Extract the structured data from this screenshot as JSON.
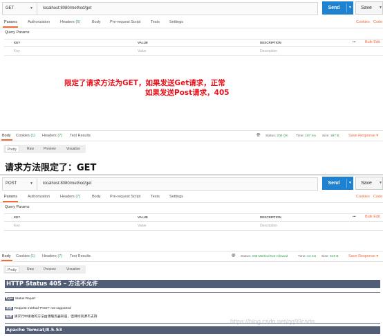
{
  "panel1": {
    "method": "GET",
    "url": "localhost:8080/method/get",
    "send": "Send",
    "save": "Save",
    "tabs": [
      "Params",
      "Authorization",
      "Headers",
      "Body",
      "Pre-request Script",
      "Tests",
      "Settings"
    ],
    "headers_count": "(6)",
    "cookies": "Cookies",
    "code": "Code",
    "query_params": "Query Params",
    "columns": [
      "KEY",
      "VALUE",
      "DESCRIPTION"
    ],
    "dots": "•••",
    "bulk_edit": "Bulk Edit",
    "placeholders": [
      "Key",
      "Value",
      "Description"
    ]
  },
  "annotation": {
    "line1": "限定了请求方法为GET，如果发送Get请求，正常",
    "line2": "如果发送Post请求，405",
    "color": "#e8101b"
  },
  "response1": {
    "tabs": [
      "Body",
      "Cookies",
      "(1)",
      "Headers",
      "(7)",
      "Test Results"
    ],
    "status_label": "Status:",
    "status_value": "200 OK",
    "time_label": "Time:",
    "time_value": "197 ms",
    "size_label": "Size:",
    "size_value": "387 B",
    "save_response": "Save Response",
    "view_tabs": [
      "Pretty",
      "Raw",
      "Preview",
      "Visualize"
    ]
  },
  "heading": "请求方法限定了：GET",
  "panel2": {
    "method": "POST",
    "url": "localhost:8080/method/get",
    "send": "Send",
    "save": "Save",
    "tabs": [
      "Params",
      "Authorization",
      "Headers",
      "Body",
      "Pre-request Script",
      "Tests",
      "Settings"
    ],
    "headers_count": "(7)",
    "cookies": "Cookies",
    "code": "Code",
    "query_params": "Query Params",
    "columns": [
      "KEY",
      "VALUE",
      "DESCRIPTION"
    ],
    "dots": "•••",
    "bulk_edit": "Bulk Edit",
    "placeholders": [
      "Key",
      "Value",
      "Description"
    ]
  },
  "response2": {
    "tabs": [
      "Body",
      "Cookies",
      "(1)",
      "Headers",
      "(7)",
      "Test Results"
    ],
    "status_label": "Status:",
    "status_value": "405 Method Not Allowed",
    "time_label": "Time:",
    "time_value": "24 ms",
    "size_label": "Size:",
    "size_value": "919 B",
    "save_response": "Save Response",
    "view_tabs": [
      "Pretty",
      "Raw",
      "Preview",
      "Visualize"
    ]
  },
  "tomcat": {
    "title": "HTTP Status 405 – 方法不允许",
    "type_key": "Type",
    "type_val": "Status Report",
    "message_key": "消息",
    "message_val": "Request method 'POST' not supported",
    "desc_key": "描述",
    "desc_val": "请求行中接收的方法由源服务器知道，但目标资源不支持",
    "footer": "Apache Tomcat/8.5.53"
  },
  "watermark": "https://blog.csdn.net/qq99csdn"
}
